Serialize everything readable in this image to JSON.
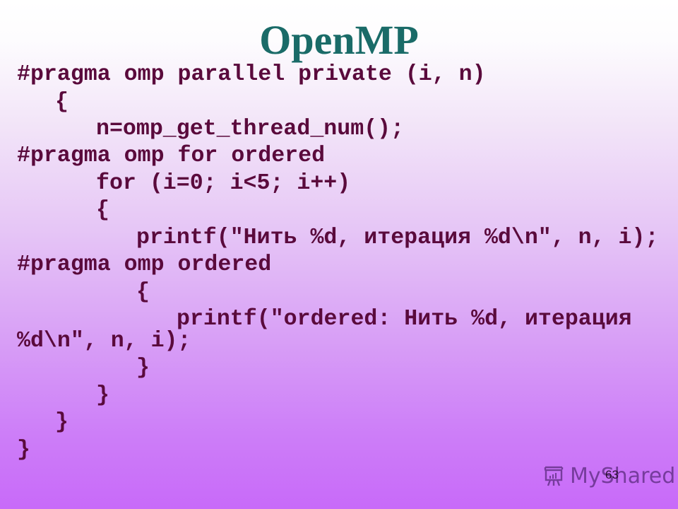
{
  "slide": {
    "title": "OpenMP",
    "code_lines": [
      "#pragma omp parallel private (i, n)",
      "{",
      "n=omp_get_thread_num();",
      "#pragma omp for ordered",
      "for (i=0; i<5; i++)",
      "{",
      "printf(\"Нить %d, итерация %d\\n\", n, i);",
      "#pragma omp ordered",
      "{",
      "printf(\"ordered: Нить %d, итерация",
      "%d\\n\", n, i);",
      "}",
      "}",
      "}",
      "}"
    ],
    "page_number": "63",
    "watermark": {
      "icon": "presentation-board-icon",
      "text": "MyShared"
    },
    "colors": {
      "title": "#1a6b68",
      "code": "#5a0a3c",
      "background_top": "#ffffff",
      "background_bottom": "#c86af9"
    }
  }
}
